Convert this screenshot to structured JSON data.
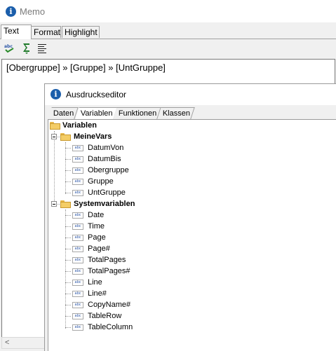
{
  "window": {
    "title": "Memo"
  },
  "tabs": [
    {
      "label": "Text",
      "active": true
    },
    {
      "label": "Format",
      "active": false
    },
    {
      "label": "Highlight",
      "active": false
    }
  ],
  "toolbar": {
    "buttons": [
      {
        "icon": "abc-spellcheck-icon"
      },
      {
        "icon": "sigma-icon"
      },
      {
        "icon": "align-left-icon"
      }
    ]
  },
  "editor": {
    "text": "[Obergruppe] » [Gruppe] » [UntGruppe]"
  },
  "dialog": {
    "title": "Ausdruckseditor",
    "tabs": [
      {
        "label": "Daten",
        "active": false
      },
      {
        "label": "Variablen",
        "active": true
      },
      {
        "label": "Funktionen",
        "active": false
      },
      {
        "label": "Klassen",
        "active": false
      }
    ],
    "tree": {
      "root": "Variablen",
      "groups": [
        {
          "label": "MeineVars",
          "items": [
            "DatumVon",
            "DatumBis",
            "Obergruppe",
            "Gruppe",
            "UntGruppe"
          ]
        },
        {
          "label": "Systemvariablen",
          "items": [
            "Date",
            "Time",
            "Page",
            "Page#",
            "TotalPages",
            "TotalPages#",
            "Line",
            "Line#",
            "CopyName#",
            "TableRow",
            "TableColumn"
          ]
        }
      ]
    }
  },
  "colors": {
    "info_icon": "#1b5eab",
    "folder": "#f4cd66",
    "var_icon_text": "#2b55a6"
  }
}
